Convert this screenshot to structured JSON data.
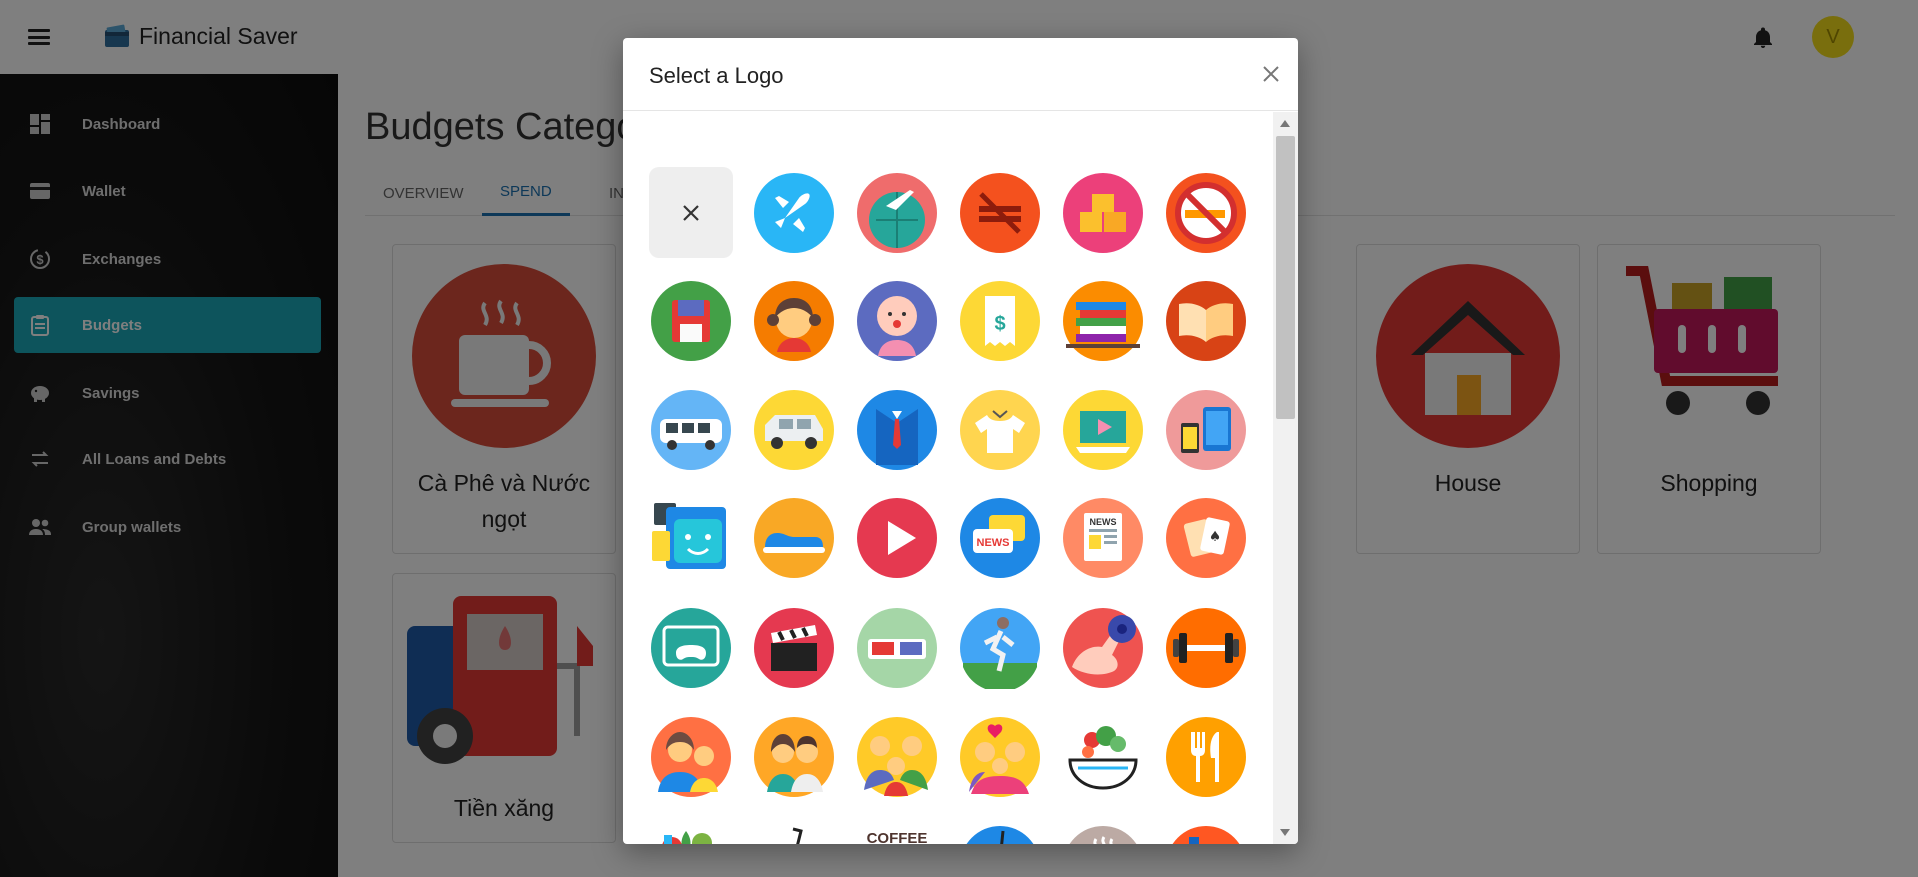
{
  "app": {
    "title": "Financial Saver",
    "avatar_initial": "V"
  },
  "sidebar": {
    "items": [
      {
        "label": "Dashboard",
        "icon": "dashboard-icon",
        "active": false
      },
      {
        "label": "Wallet",
        "icon": "wallet-icon",
        "active": false
      },
      {
        "label": "Exchanges",
        "icon": "exchange-icon",
        "active": false
      },
      {
        "label": "Budgets",
        "icon": "clipboard-icon",
        "active": true
      },
      {
        "label": "Savings",
        "icon": "piggy-bank-icon",
        "active": false
      },
      {
        "label": "All Loans and Debts",
        "icon": "swap-arrows-icon",
        "active": false
      },
      {
        "label": "Group wallets",
        "icon": "group-icon",
        "active": false
      }
    ]
  },
  "main": {
    "title": "Budgets Catego",
    "tabs": [
      {
        "label": "OVERVIEW",
        "active": false
      },
      {
        "label": "SPEND",
        "active": true
      },
      {
        "label": "INC",
        "active": false
      }
    ],
    "cards": [
      {
        "label_line1": "Cà Phê và Nước",
        "label_line2": "ngọt",
        "icon": "coffee-cup-icon"
      },
      {
        "label_line1": "House",
        "icon": "house-icon"
      },
      {
        "label_line1": "Shopping",
        "icon": "shopping-cart-icon"
      },
      {
        "label_line1": "Tiền xăng",
        "icon": "gas-station-icon"
      }
    ]
  },
  "modal": {
    "title": "Select a Logo",
    "logos": [
      {
        "name": "no-logo",
        "bg": "#eeeeee"
      },
      {
        "name": "airplane",
        "bg": "#29b6f6"
      },
      {
        "name": "globe-flight",
        "bg": "#ef6c6c"
      },
      {
        "name": "no-flights",
        "bg": "#f4511e"
      },
      {
        "name": "boxes",
        "bg": "#ec407a"
      },
      {
        "name": "no-smoking",
        "bg": "#f4511e"
      },
      {
        "name": "floppy-disk",
        "bg": "#43a047"
      },
      {
        "name": "girl",
        "bg": "#f57c00"
      },
      {
        "name": "baby",
        "bg": "#5c6bc0"
      },
      {
        "name": "receipt",
        "bg": "#fdd835"
      },
      {
        "name": "book-stack",
        "bg": "#fb8c00"
      },
      {
        "name": "open-book",
        "bg": "#d84315"
      },
      {
        "name": "bus",
        "bg": "#64b5f6"
      },
      {
        "name": "van",
        "bg": "#fdd835"
      },
      {
        "name": "suit",
        "bg": "#1e88e5"
      },
      {
        "name": "t-shirt",
        "bg": "#ffd54f"
      },
      {
        "name": "tutorial-book",
        "bg": "#fdd835"
      },
      {
        "name": "devices",
        "bg": "#ef9a9a"
      },
      {
        "name": "chat-bot",
        "bg": "#ffffff"
      },
      {
        "name": "sneaker",
        "bg": "#f9a825"
      },
      {
        "name": "play-video",
        "bg": "#e53950"
      },
      {
        "name": "news-chat",
        "bg": "#1e88e5"
      },
      {
        "name": "newspaper",
        "bg": "#ff8a65"
      },
      {
        "name": "playing-cards",
        "bg": "#ff7043"
      },
      {
        "name": "game-console",
        "bg": "#26a69a"
      },
      {
        "name": "clapperboard",
        "bg": "#e53950"
      },
      {
        "name": "3d-glasses",
        "bg": "#a5d6a7"
      },
      {
        "name": "runner",
        "bg": "#42a5f5"
      },
      {
        "name": "muscle-arm",
        "bg": "#ef5350"
      },
      {
        "name": "dumbbell",
        "bg": "#ff6d00"
      },
      {
        "name": "family-mom-kids",
        "bg": "#ff7043"
      },
      {
        "name": "couple",
        "bg": "#ffa726"
      },
      {
        "name": "family",
        "bg": "#ffca28"
      },
      {
        "name": "family-hug",
        "bg": "#ffca28"
      },
      {
        "name": "salad-bowl",
        "bg": "#ffffff"
      },
      {
        "name": "fork-knife",
        "bg": "#ffa000"
      },
      {
        "name": "groceries",
        "bg": "#ffffff"
      },
      {
        "name": "fast-food",
        "bg": "#ffffff"
      },
      {
        "name": "coffee-shop",
        "bg": "#ffffff"
      },
      {
        "name": "milk-tea",
        "bg": "#1e88e5"
      },
      {
        "name": "coffee-cup",
        "bg": "#bcaaa4"
      },
      {
        "name": "water-bottle",
        "bg": "#ff5722"
      }
    ],
    "coffee_sign": "COFFEE",
    "news_text": "NEWS"
  }
}
